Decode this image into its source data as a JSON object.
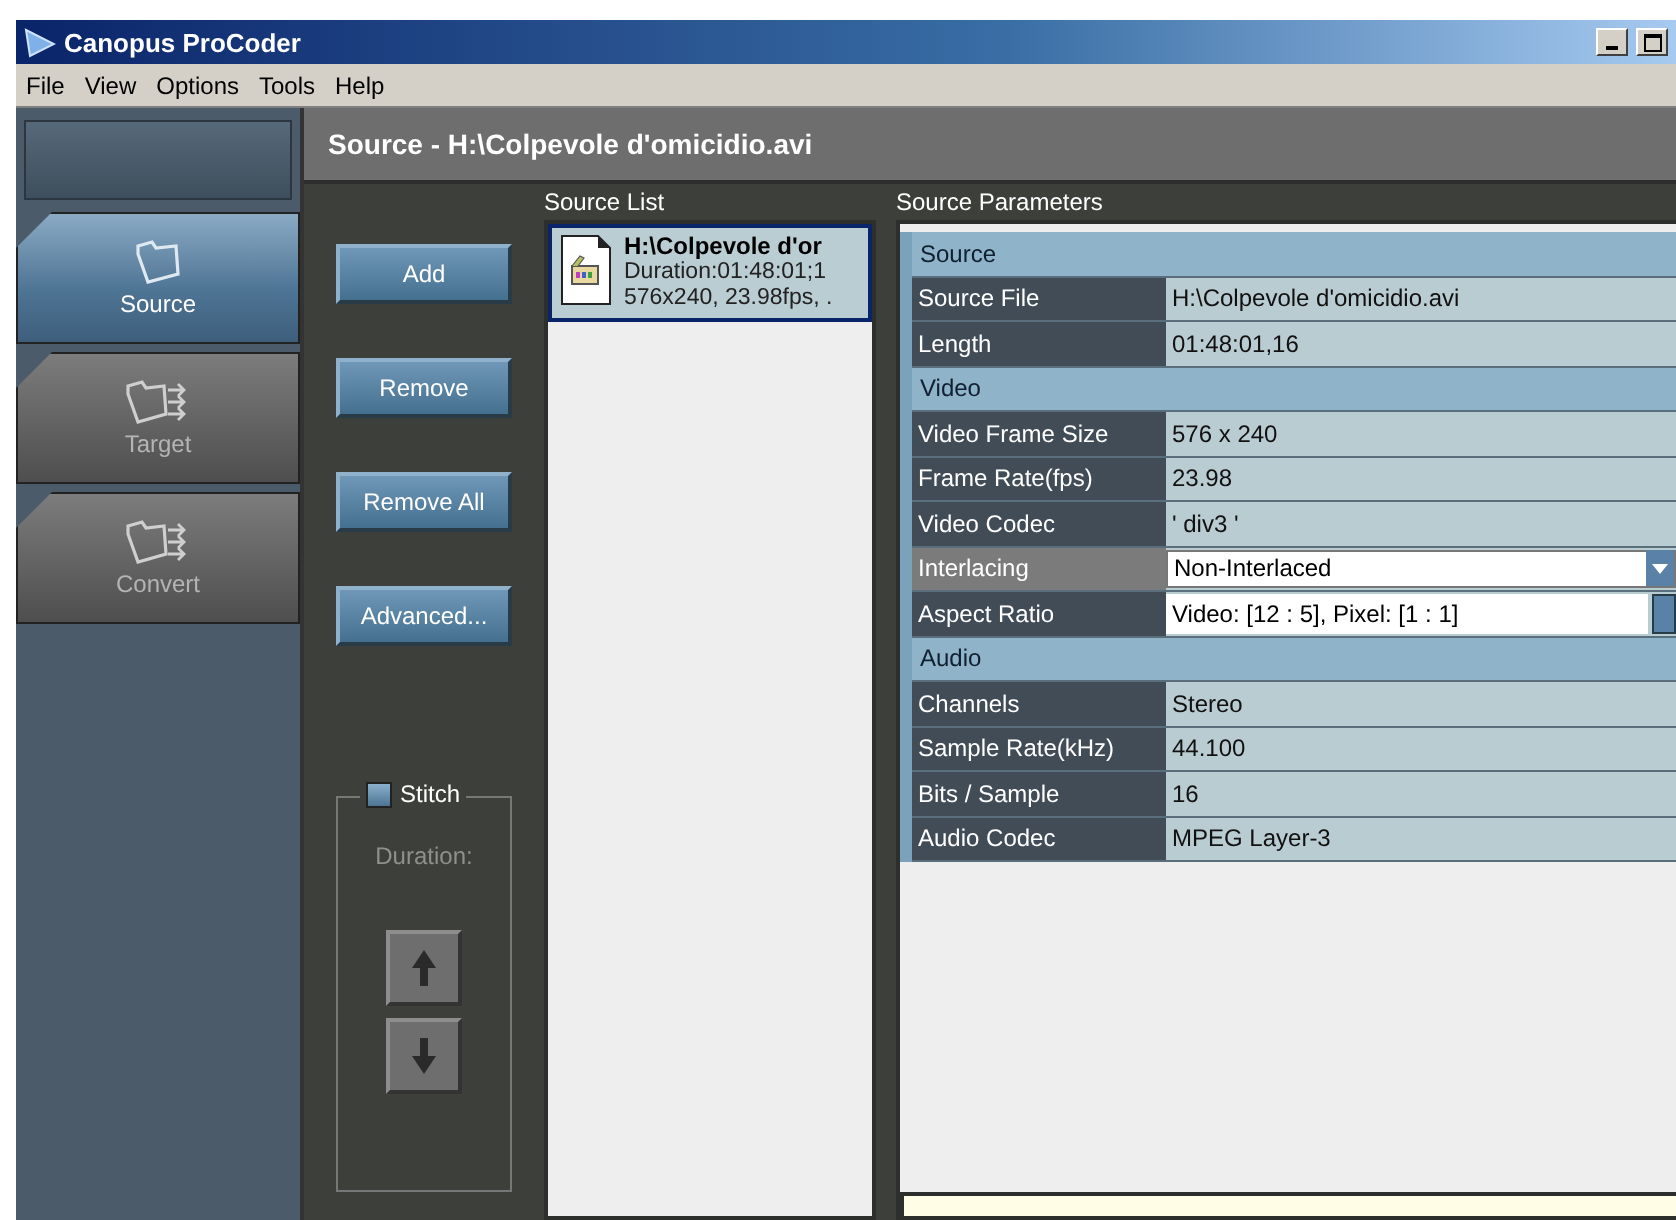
{
  "window": {
    "title": "Canopus ProCoder"
  },
  "menu": [
    "File",
    "View",
    "Options",
    "Tools",
    "Help"
  ],
  "nav_tabs": [
    {
      "label": "Source",
      "selected": true
    },
    {
      "label": "Target",
      "selected": false
    },
    {
      "label": "Convert",
      "selected": false
    }
  ],
  "page_title": "Source - H:\\Colpevole d'omicidio.avi",
  "buttons": [
    "Add",
    "Remove",
    "Remove All",
    "Advanced..."
  ],
  "stitch": {
    "label": "Stitch",
    "checked": false,
    "duration_label": "Duration:"
  },
  "source_list": {
    "label": "Source List",
    "items": [
      {
        "name": "H:\\Colpevole d'or",
        "duration": "Duration:01:48:01;1",
        "info": "576x240, 23.98fps, .",
        "selected": true
      }
    ]
  },
  "source_parameters": {
    "label": "Source Parameters",
    "rows": [
      {
        "kind": "section",
        "label": "Source"
      },
      {
        "kind": "text",
        "label": "Source File",
        "value": "H:\\Colpevole d'omicidio.avi",
        "selected": false
      },
      {
        "kind": "text",
        "label": "Length",
        "value": "01:48:01,16",
        "selected": false
      },
      {
        "kind": "section",
        "label": "Video"
      },
      {
        "kind": "text",
        "label": "Video Frame Size",
        "value": "576 x 240",
        "selected": false
      },
      {
        "kind": "text",
        "label": "Frame Rate(fps)",
        "value": "23.98",
        "selected": false
      },
      {
        "kind": "text",
        "label": "Video Codec",
        "value": "' div3 '",
        "selected": false
      },
      {
        "kind": "dropdown",
        "label": "Interlacing",
        "value": "Non-Interlaced",
        "selected": true
      },
      {
        "kind": "browse",
        "label": "Aspect Ratio",
        "value": "Video: [12 : 5], Pixel: [1 : 1]",
        "selected": false
      },
      {
        "kind": "section",
        "label": "Audio"
      },
      {
        "kind": "text",
        "label": "Channels",
        "value": "Stereo",
        "selected": false
      },
      {
        "kind": "text",
        "label": "Sample Rate(kHz)",
        "value": "44.100",
        "selected": false
      },
      {
        "kind": "text",
        "label": "Bits / Sample",
        "value": "16",
        "selected": false
      },
      {
        "kind": "text",
        "label": "Audio Codec",
        "value": "MPEG Layer-3",
        "selected": false
      }
    ]
  }
}
